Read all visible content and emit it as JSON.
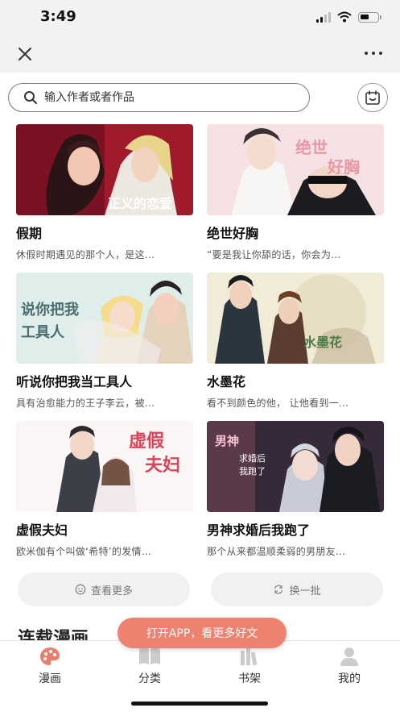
{
  "status_bar": {
    "time": "3:49"
  },
  "search": {
    "placeholder": "输入作者或者作品"
  },
  "comics": [
    {
      "title": "假期",
      "desc": "休假时期遇见的那个人，是这..."
    },
    {
      "title": "绝世好胸",
      "desc": "“要是我让你舔的话，你会为..."
    },
    {
      "title": "听说你把我当工具人",
      "desc": "具有治愈能力的王子李云，被..."
    },
    {
      "title": "水墨花",
      "desc": "看不到颜色的他，  让他看到一..."
    },
    {
      "title": "虚假夫妇",
      "desc": "欧米伽有个叫做‘希特’的发情..."
    },
    {
      "title": "男神求婚后我跑了",
      "desc": "那个从来都温顺柔弱的男朋友..."
    }
  ],
  "actions": {
    "see_more": "查看更多",
    "refresh": "换一批"
  },
  "section": {
    "title": "连载漫画"
  },
  "open_app": "打开APP，看更多好文",
  "tabs": [
    {
      "label": "漫画",
      "icon": "palette-icon",
      "color": "#e9806e"
    },
    {
      "label": "分类",
      "icon": "book-icon",
      "color": "#cccccc"
    },
    {
      "label": "书架",
      "icon": "bookshelf-icon",
      "color": "#cccccc"
    },
    {
      "label": "我的",
      "icon": "user-icon",
      "color": "#cccccc"
    }
  ],
  "colors": {
    "accent": "#ee8270",
    "nav_bg": "#f2f2f2"
  }
}
